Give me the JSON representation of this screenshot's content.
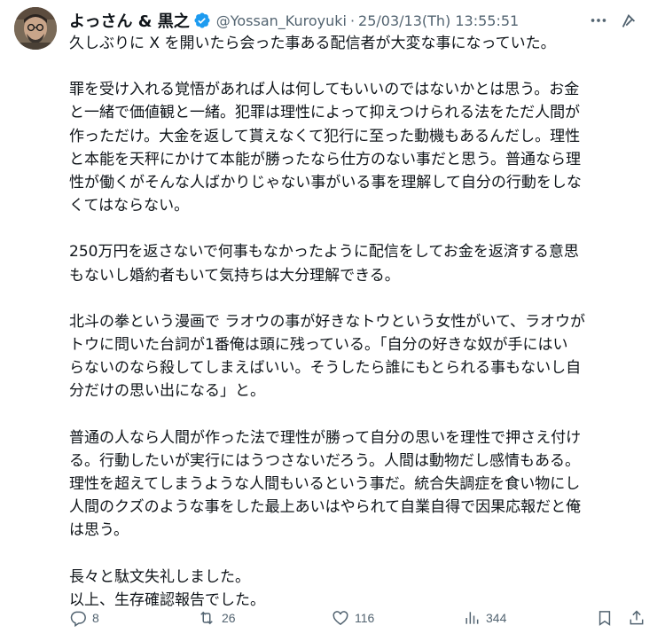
{
  "user": {
    "display_name": "よっさん & 黒之",
    "handle": "@Yossan_Kuroyuki",
    "separator": "·",
    "timestamp": "25/03/13(Th) 13:55:51",
    "verified": true
  },
  "paragraphs": [
    [
      "久しぶりに X を開いたら会った事ある配信者が大変な事になっていた。"
    ],
    [
      "罪を受け入れる覚悟があれば人は何してもいいのではないかとは思う。お金",
      "と一緒で価値観と一緒。犯罪は理性によって抑えつけられる法をただ人間が",
      "作っただけ。大金を返して貰えなくて犯行に至った動機もあるんだし。理性",
      "と本能を天秤にかけて本能が勝ったなら仕方のない事だと思う。普通なら理",
      "性が働くがそんな人ばかりじゃない事がいる事を理解して自分の行動をしな",
      "くてはならない。"
    ],
    [
      "250万円を返さないで何事もなかったように配信をしてお金を返済する意思",
      "もないし婚約者もいて気持ちは大分理解できる。"
    ],
    [
      "北斗の拳という漫画で ラオウの事が好きなトウという女性がいて、ラオウが",
      "トウに問いた台詞が1番俺は頭に残っている。「自分の好きな奴が手にはい",
      "らないのなら殺してしまえばいい。そうしたら誰にもとられる事もないし自",
      "分だけの思い出になる」と。"
    ],
    [
      "普通の人なら人間が作った法で理性が勝って自分の思いを理性で押さえ付け",
      "る。行動したいが実行にはうつさないだろう。人間は動物だし感情もある。",
      "理性を超えてしまうような人間もいるという事だ。統合失調症を食い物にし",
      "人間のクズのような事をした最上あいはやられて自業自得で因果応報だと俺",
      "は思う。"
    ],
    [
      "長々と駄文失礼しました。",
      "以上、生存確認報告でした。"
    ]
  ],
  "actions": {
    "replies": "8",
    "retweets": "26",
    "likes": "116",
    "views": "344"
  },
  "icons": {
    "more": "more-icon",
    "grok": "grok-icon",
    "reply": "reply-icon",
    "retweet": "retweet-icon",
    "like": "heart-icon",
    "views": "views-icon",
    "bookmark": "bookmark-icon",
    "share": "share-icon"
  },
  "colors": {
    "text": "#0f1419",
    "secondary": "#536471",
    "verified": "#1d9bf0"
  }
}
